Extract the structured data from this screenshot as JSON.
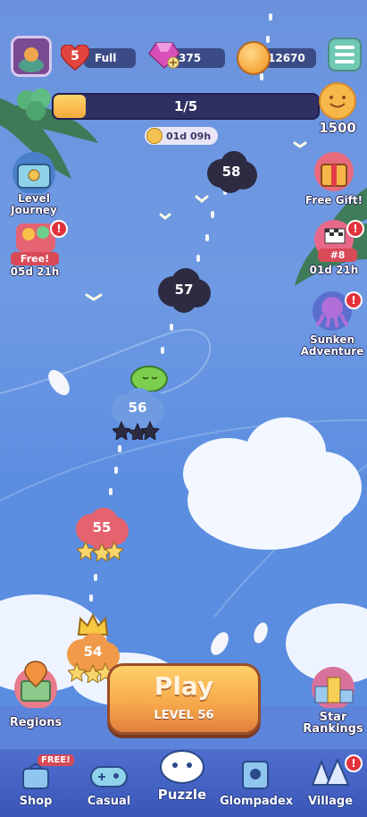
{
  "topbar": {
    "lives_count": "5",
    "lives_status": "Full",
    "gems": "375",
    "coins": "12670"
  },
  "progress": {
    "text": "1/5",
    "fraction": 0.12,
    "timer": "01d 09h",
    "reward": "1500"
  },
  "left_features": {
    "level_journey": "Level Journey",
    "free_tag": "Free!",
    "free_timer": "05d 21h",
    "regions": "Regions"
  },
  "right_features": {
    "free_gift": "Free Gift!",
    "rank_tag": "#8",
    "rank_timer": "01d 21h",
    "sunken": "Sunken Adventure",
    "star_rankings": "Star Rankings"
  },
  "badges": {
    "exclaim": "!",
    "shop_free": "FREE!"
  },
  "levels": {
    "l58": "58",
    "l57": "57",
    "l56": "56",
    "l55": "55",
    "l54": "54"
  },
  "play": {
    "title": "Play",
    "subtitle": "LEVEL 56"
  },
  "nav": {
    "shop": "Shop",
    "casual": "Casual",
    "puzzle": "Puzzle",
    "glompadex": "Glompadex",
    "village": "Village"
  },
  "colors": {
    "sky": "#6b93dd",
    "accent_orange": "#f6a64a",
    "node_dark": "#2c2a3e",
    "node_blue": "#6f9be0",
    "node_pink": "#e5636f",
    "node_orange": "#f09a4a"
  }
}
